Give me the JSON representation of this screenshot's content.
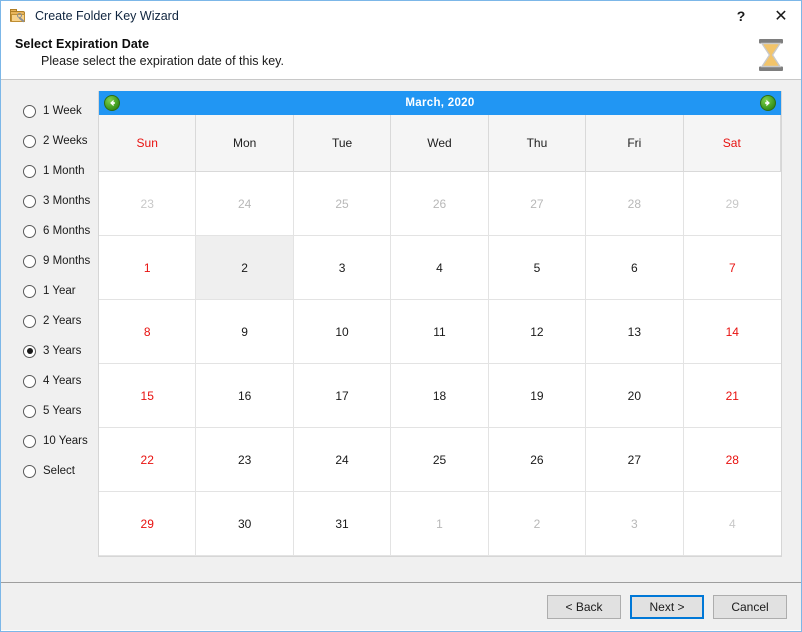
{
  "window": {
    "title": "Create Folder Key Wizard",
    "icon": "folder-key-icon",
    "help_label": "?",
    "close_label": "✕",
    "border_color": "#7cb7e8"
  },
  "header": {
    "title": "Select Expiration Date",
    "subtitle": "Please select the expiration date of this key.",
    "icon": "hourglass-icon"
  },
  "sidebar": {
    "selected": "3 Years",
    "options": [
      {
        "label": "1 Week",
        "checked": false
      },
      {
        "label": "2 Weeks",
        "checked": false
      },
      {
        "label": "1 Month",
        "checked": false
      },
      {
        "label": "3 Months",
        "checked": false
      },
      {
        "label": "6 Months",
        "checked": false
      },
      {
        "label": "9 Months",
        "checked": false
      },
      {
        "label": "1 Year",
        "checked": false
      },
      {
        "label": "2 Years",
        "checked": false
      },
      {
        "label": "3 Years",
        "checked": true
      },
      {
        "label": "4 Years",
        "checked": false
      },
      {
        "label": "5 Years",
        "checked": false
      },
      {
        "label": "10 Years",
        "checked": false
      },
      {
        "label": "Select",
        "checked": false
      }
    ]
  },
  "calendar": {
    "month_year": "March,  2020",
    "prev_label": "previous-month",
    "next_label": "next-month",
    "header_color": "#2196f3",
    "weekend_color": "#e8110f",
    "selected_day": 2,
    "day_headers": [
      {
        "label": "Sun",
        "weekend": true
      },
      {
        "label": "Mon",
        "weekend": false
      },
      {
        "label": "Tue",
        "weekend": false
      },
      {
        "label": "Wed",
        "weekend": false
      },
      {
        "label": "Thu",
        "weekend": false
      },
      {
        "label": "Fri",
        "weekend": false
      },
      {
        "label": "Sat",
        "weekend": true
      }
    ],
    "weeks": [
      [
        {
          "d": "23",
          "other": true,
          "weekend": true,
          "today": false
        },
        {
          "d": "24",
          "other": true,
          "weekend": false,
          "today": false
        },
        {
          "d": "25",
          "other": true,
          "weekend": false,
          "today": false
        },
        {
          "d": "26",
          "other": true,
          "weekend": false,
          "today": false
        },
        {
          "d": "27",
          "other": true,
          "weekend": false,
          "today": false
        },
        {
          "d": "28",
          "other": true,
          "weekend": false,
          "today": false
        },
        {
          "d": "29",
          "other": true,
          "weekend": true,
          "today": false
        }
      ],
      [
        {
          "d": "1",
          "other": false,
          "weekend": true,
          "today": false
        },
        {
          "d": "2",
          "other": false,
          "weekend": false,
          "today": true
        },
        {
          "d": "3",
          "other": false,
          "weekend": false,
          "today": false
        },
        {
          "d": "4",
          "other": false,
          "weekend": false,
          "today": false
        },
        {
          "d": "5",
          "other": false,
          "weekend": false,
          "today": false
        },
        {
          "d": "6",
          "other": false,
          "weekend": false,
          "today": false
        },
        {
          "d": "7",
          "other": false,
          "weekend": true,
          "today": false
        }
      ],
      [
        {
          "d": "8",
          "other": false,
          "weekend": true,
          "today": false
        },
        {
          "d": "9",
          "other": false,
          "weekend": false,
          "today": false
        },
        {
          "d": "10",
          "other": false,
          "weekend": false,
          "today": false
        },
        {
          "d": "11",
          "other": false,
          "weekend": false,
          "today": false
        },
        {
          "d": "12",
          "other": false,
          "weekend": false,
          "today": false
        },
        {
          "d": "13",
          "other": false,
          "weekend": false,
          "today": false
        },
        {
          "d": "14",
          "other": false,
          "weekend": true,
          "today": false
        }
      ],
      [
        {
          "d": "15",
          "other": false,
          "weekend": true,
          "today": false
        },
        {
          "d": "16",
          "other": false,
          "weekend": false,
          "today": false
        },
        {
          "d": "17",
          "other": false,
          "weekend": false,
          "today": false
        },
        {
          "d": "18",
          "other": false,
          "weekend": false,
          "today": false
        },
        {
          "d": "19",
          "other": false,
          "weekend": false,
          "today": false
        },
        {
          "d": "20",
          "other": false,
          "weekend": false,
          "today": false
        },
        {
          "d": "21",
          "other": false,
          "weekend": true,
          "today": false
        }
      ],
      [
        {
          "d": "22",
          "other": false,
          "weekend": true,
          "today": false
        },
        {
          "d": "23",
          "other": false,
          "weekend": false,
          "today": false
        },
        {
          "d": "24",
          "other": false,
          "weekend": false,
          "today": false
        },
        {
          "d": "25",
          "other": false,
          "weekend": false,
          "today": false
        },
        {
          "d": "26",
          "other": false,
          "weekend": false,
          "today": false
        },
        {
          "d": "27",
          "other": false,
          "weekend": false,
          "today": false
        },
        {
          "d": "28",
          "other": false,
          "weekend": true,
          "today": false
        }
      ],
      [
        {
          "d": "29",
          "other": false,
          "weekend": true,
          "today": false
        },
        {
          "d": "30",
          "other": false,
          "weekend": false,
          "today": false
        },
        {
          "d": "31",
          "other": false,
          "weekend": false,
          "today": false
        },
        {
          "d": "1",
          "other": true,
          "weekend": false,
          "today": false
        },
        {
          "d": "2",
          "other": true,
          "weekend": false,
          "today": false
        },
        {
          "d": "3",
          "other": true,
          "weekend": false,
          "today": false
        },
        {
          "d": "4",
          "other": true,
          "weekend": true,
          "today": false
        }
      ]
    ]
  },
  "footer": {
    "back_label": "< Back",
    "next_label": "Next >",
    "cancel_label": "Cancel",
    "default_button": "Next >"
  }
}
